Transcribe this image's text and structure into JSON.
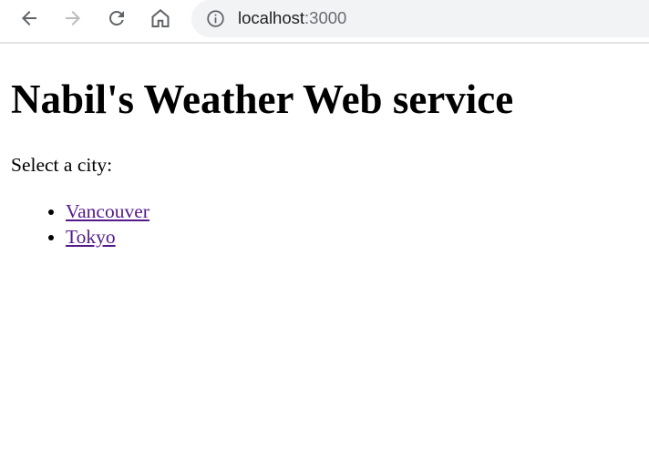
{
  "browser": {
    "url_host": "localhost",
    "url_port": ":3000",
    "icons": {
      "back": "back-arrow-icon",
      "forward": "forward-arrow-icon",
      "reload": "reload-icon",
      "home": "home-icon",
      "site_info": "info-icon"
    },
    "colors": {
      "icon_active": "#5f6368",
      "icon_disabled": "#babcbe",
      "omnibox_bg": "#f1f3f4"
    }
  },
  "page": {
    "title": "Nabil's Weather Web service",
    "prompt": "Select a city:",
    "cities": [
      {
        "label": "Vancouver"
      },
      {
        "label": "Tokyo"
      }
    ],
    "colors": {
      "visited_link": "#551a8b"
    }
  }
}
